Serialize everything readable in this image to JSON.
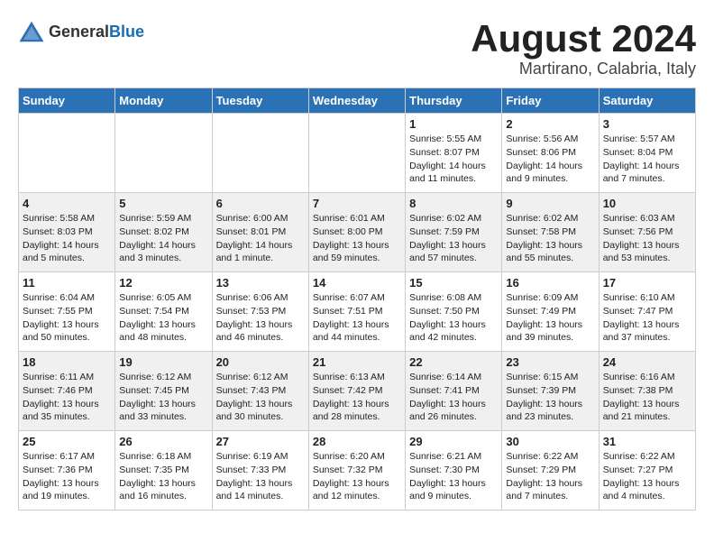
{
  "header": {
    "logo_general": "General",
    "logo_blue": "Blue",
    "month_title": "August 2024",
    "location": "Martirano, Calabria, Italy"
  },
  "days_of_week": [
    "Sunday",
    "Monday",
    "Tuesday",
    "Wednesday",
    "Thursday",
    "Friday",
    "Saturday"
  ],
  "weeks": [
    [
      {
        "day": "",
        "info": ""
      },
      {
        "day": "",
        "info": ""
      },
      {
        "day": "",
        "info": ""
      },
      {
        "day": "",
        "info": ""
      },
      {
        "day": "1",
        "info": "Sunrise: 5:55 AM\nSunset: 8:07 PM\nDaylight: 14 hours\nand 11 minutes."
      },
      {
        "day": "2",
        "info": "Sunrise: 5:56 AM\nSunset: 8:06 PM\nDaylight: 14 hours\nand 9 minutes."
      },
      {
        "day": "3",
        "info": "Sunrise: 5:57 AM\nSunset: 8:04 PM\nDaylight: 14 hours\nand 7 minutes."
      }
    ],
    [
      {
        "day": "4",
        "info": "Sunrise: 5:58 AM\nSunset: 8:03 PM\nDaylight: 14 hours\nand 5 minutes."
      },
      {
        "day": "5",
        "info": "Sunrise: 5:59 AM\nSunset: 8:02 PM\nDaylight: 14 hours\nand 3 minutes."
      },
      {
        "day": "6",
        "info": "Sunrise: 6:00 AM\nSunset: 8:01 PM\nDaylight: 14 hours\nand 1 minute."
      },
      {
        "day": "7",
        "info": "Sunrise: 6:01 AM\nSunset: 8:00 PM\nDaylight: 13 hours\nand 59 minutes."
      },
      {
        "day": "8",
        "info": "Sunrise: 6:02 AM\nSunset: 7:59 PM\nDaylight: 13 hours\nand 57 minutes."
      },
      {
        "day": "9",
        "info": "Sunrise: 6:02 AM\nSunset: 7:58 PM\nDaylight: 13 hours\nand 55 minutes."
      },
      {
        "day": "10",
        "info": "Sunrise: 6:03 AM\nSunset: 7:56 PM\nDaylight: 13 hours\nand 53 minutes."
      }
    ],
    [
      {
        "day": "11",
        "info": "Sunrise: 6:04 AM\nSunset: 7:55 PM\nDaylight: 13 hours\nand 50 minutes."
      },
      {
        "day": "12",
        "info": "Sunrise: 6:05 AM\nSunset: 7:54 PM\nDaylight: 13 hours\nand 48 minutes."
      },
      {
        "day": "13",
        "info": "Sunrise: 6:06 AM\nSunset: 7:53 PM\nDaylight: 13 hours\nand 46 minutes."
      },
      {
        "day": "14",
        "info": "Sunrise: 6:07 AM\nSunset: 7:51 PM\nDaylight: 13 hours\nand 44 minutes."
      },
      {
        "day": "15",
        "info": "Sunrise: 6:08 AM\nSunset: 7:50 PM\nDaylight: 13 hours\nand 42 minutes."
      },
      {
        "day": "16",
        "info": "Sunrise: 6:09 AM\nSunset: 7:49 PM\nDaylight: 13 hours\nand 39 minutes."
      },
      {
        "day": "17",
        "info": "Sunrise: 6:10 AM\nSunset: 7:47 PM\nDaylight: 13 hours\nand 37 minutes."
      }
    ],
    [
      {
        "day": "18",
        "info": "Sunrise: 6:11 AM\nSunset: 7:46 PM\nDaylight: 13 hours\nand 35 minutes."
      },
      {
        "day": "19",
        "info": "Sunrise: 6:12 AM\nSunset: 7:45 PM\nDaylight: 13 hours\nand 33 minutes."
      },
      {
        "day": "20",
        "info": "Sunrise: 6:12 AM\nSunset: 7:43 PM\nDaylight: 13 hours\nand 30 minutes."
      },
      {
        "day": "21",
        "info": "Sunrise: 6:13 AM\nSunset: 7:42 PM\nDaylight: 13 hours\nand 28 minutes."
      },
      {
        "day": "22",
        "info": "Sunrise: 6:14 AM\nSunset: 7:41 PM\nDaylight: 13 hours\nand 26 minutes."
      },
      {
        "day": "23",
        "info": "Sunrise: 6:15 AM\nSunset: 7:39 PM\nDaylight: 13 hours\nand 23 minutes."
      },
      {
        "day": "24",
        "info": "Sunrise: 6:16 AM\nSunset: 7:38 PM\nDaylight: 13 hours\nand 21 minutes."
      }
    ],
    [
      {
        "day": "25",
        "info": "Sunrise: 6:17 AM\nSunset: 7:36 PM\nDaylight: 13 hours\nand 19 minutes."
      },
      {
        "day": "26",
        "info": "Sunrise: 6:18 AM\nSunset: 7:35 PM\nDaylight: 13 hours\nand 16 minutes."
      },
      {
        "day": "27",
        "info": "Sunrise: 6:19 AM\nSunset: 7:33 PM\nDaylight: 13 hours\nand 14 minutes."
      },
      {
        "day": "28",
        "info": "Sunrise: 6:20 AM\nSunset: 7:32 PM\nDaylight: 13 hours\nand 12 minutes."
      },
      {
        "day": "29",
        "info": "Sunrise: 6:21 AM\nSunset: 7:30 PM\nDaylight: 13 hours\nand 9 minutes."
      },
      {
        "day": "30",
        "info": "Sunrise: 6:22 AM\nSunset: 7:29 PM\nDaylight: 13 hours\nand 7 minutes."
      },
      {
        "day": "31",
        "info": "Sunrise: 6:22 AM\nSunset: 7:27 PM\nDaylight: 13 hours\nand 4 minutes."
      }
    ]
  ]
}
